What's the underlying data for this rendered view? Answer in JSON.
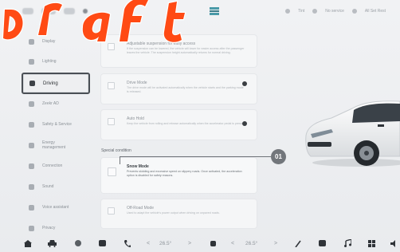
{
  "status_bar": {
    "right_items": [
      "Tint",
      "No service",
      "All Set Rest"
    ]
  },
  "sidebar": {
    "items": [
      {
        "label": "Display"
      },
      {
        "label": "Lighting"
      },
      {
        "label": "Driving"
      },
      {
        "label": "Zeekr AD"
      },
      {
        "label": "Safety & Service"
      },
      {
        "label": "Energy management"
      },
      {
        "label": "Connection"
      },
      {
        "label": "Sound"
      },
      {
        "label": "Voice assistant"
      },
      {
        "label": "Privacy"
      }
    ],
    "active_index": 2
  },
  "cards": [
    {
      "title": "Adjustable suspension for easy access",
      "desc": "If the suspension can be lowered, the vehicle will lower for easier access after the passenger leaves the vehicle. The suspension height automatically returns for normal driving.",
      "has_info": false
    },
    {
      "title": "Drive Mode",
      "desc": "The drive mode will be activated automatically when the vehicle starts and the parking mode is released.",
      "has_info": true
    },
    {
      "title": "Auto Hold",
      "desc": "Keep the vehicle from rolling and release automatically when the accelerator pedal is pressed.",
      "has_info": true
    }
  ],
  "section_label": "Special condition",
  "snow_mode": {
    "title": "Snow Mode",
    "desc": "Prevents skidding and excessive speed on slippery roads. Once activated, the acceleration option is disabled for safety reasons."
  },
  "offroad_mode": {
    "title": "Off-Road Mode",
    "desc": "Used to adapt the vehicle's power output when driving on unpaved roads."
  },
  "callout": {
    "label": "01"
  },
  "dock": {
    "left_temp": "26.5°",
    "right_temp": "26.5°",
    "left_arrow_l": "<",
    "left_arrow_r": ">",
    "right_arrow_l": "<",
    "right_arrow_r": ">"
  },
  "watermark": "Draft"
}
